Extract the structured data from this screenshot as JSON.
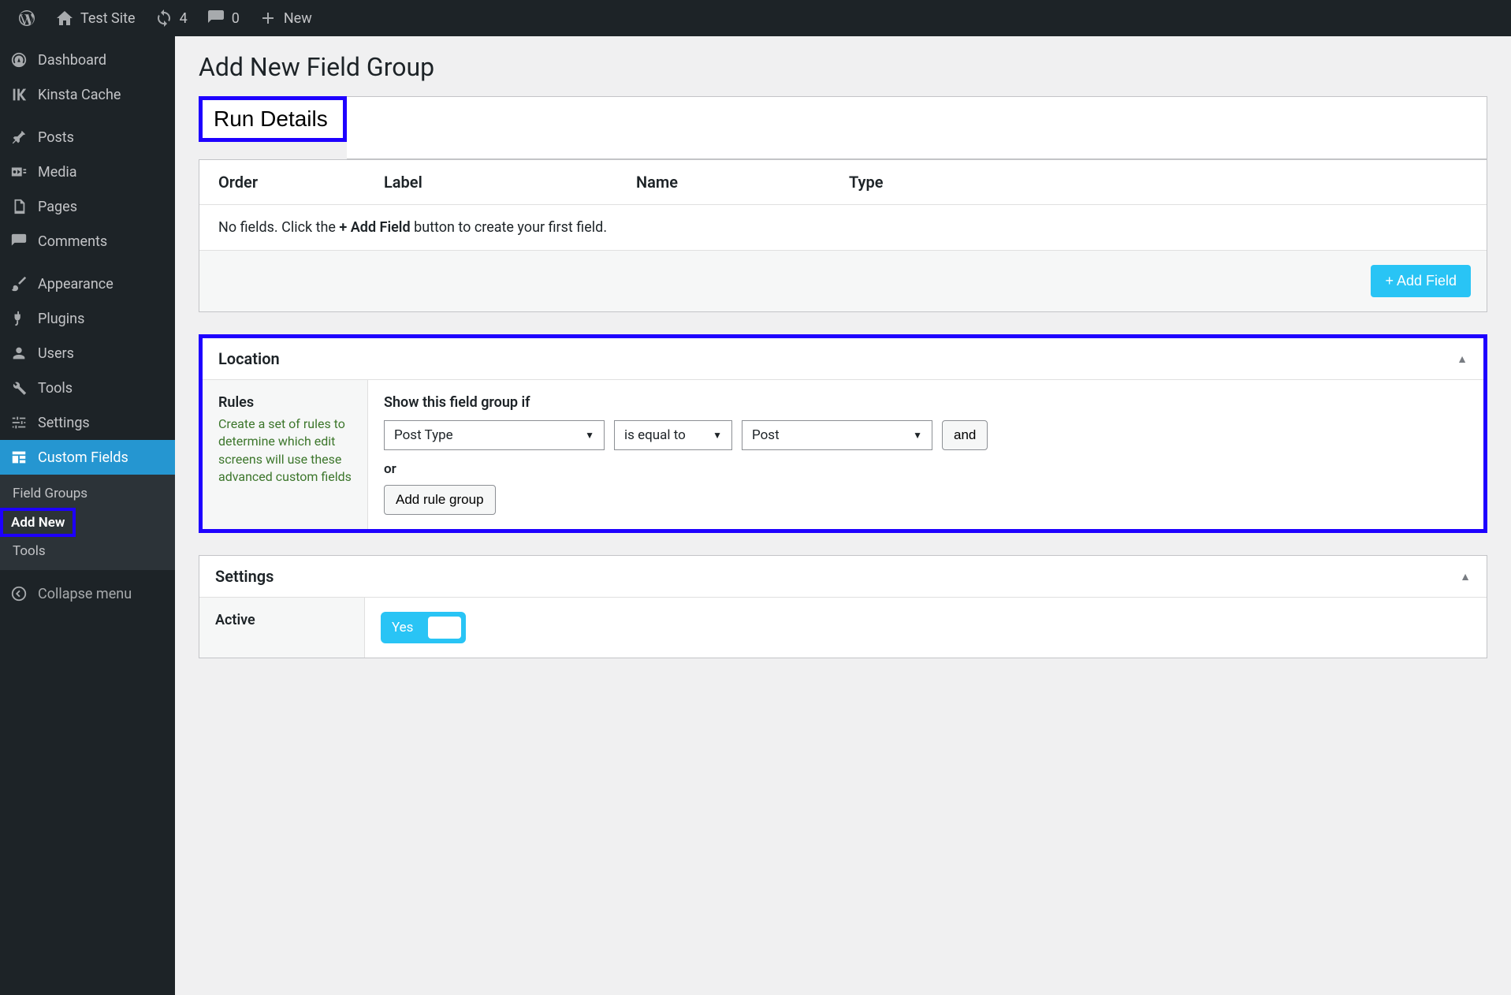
{
  "adminbar": {
    "site_name": "Test Site",
    "updates_count": "4",
    "comments_count": "0",
    "new_label": "New"
  },
  "sidebar": {
    "items": [
      {
        "label": "Dashboard"
      },
      {
        "label": "Kinsta Cache"
      },
      {
        "label": "Posts"
      },
      {
        "label": "Media"
      },
      {
        "label": "Pages"
      },
      {
        "label": "Comments"
      },
      {
        "label": "Appearance"
      },
      {
        "label": "Plugins"
      },
      {
        "label": "Users"
      },
      {
        "label": "Tools"
      },
      {
        "label": "Settings"
      },
      {
        "label": "Custom Fields"
      }
    ],
    "submenu": {
      "field_groups": "Field Groups",
      "add_new": "Add New",
      "tools": "Tools"
    },
    "collapse": "Collapse menu"
  },
  "page": {
    "title": "Add New Field Group",
    "title_input": "Run Details"
  },
  "fields": {
    "headers": {
      "order": "Order",
      "label": "Label",
      "name": "Name",
      "type": "Type"
    },
    "empty_prefix": "No fields. Click the ",
    "empty_bold": "+ Add Field",
    "empty_suffix": " button to create your first field.",
    "add_button": "+ Add Field"
  },
  "location": {
    "title": "Location",
    "rules_heading": "Rules",
    "rules_desc": "Create a set of rules to determine which edit screens will use these advanced custom fields",
    "show_if": "Show this field group if",
    "param": "Post Type",
    "operator": "is equal to",
    "value": "Post",
    "and": "and",
    "or": "or",
    "add_rule_group": "Add rule group"
  },
  "settings": {
    "title": "Settings",
    "active_label": "Active",
    "active_value": "Yes"
  }
}
